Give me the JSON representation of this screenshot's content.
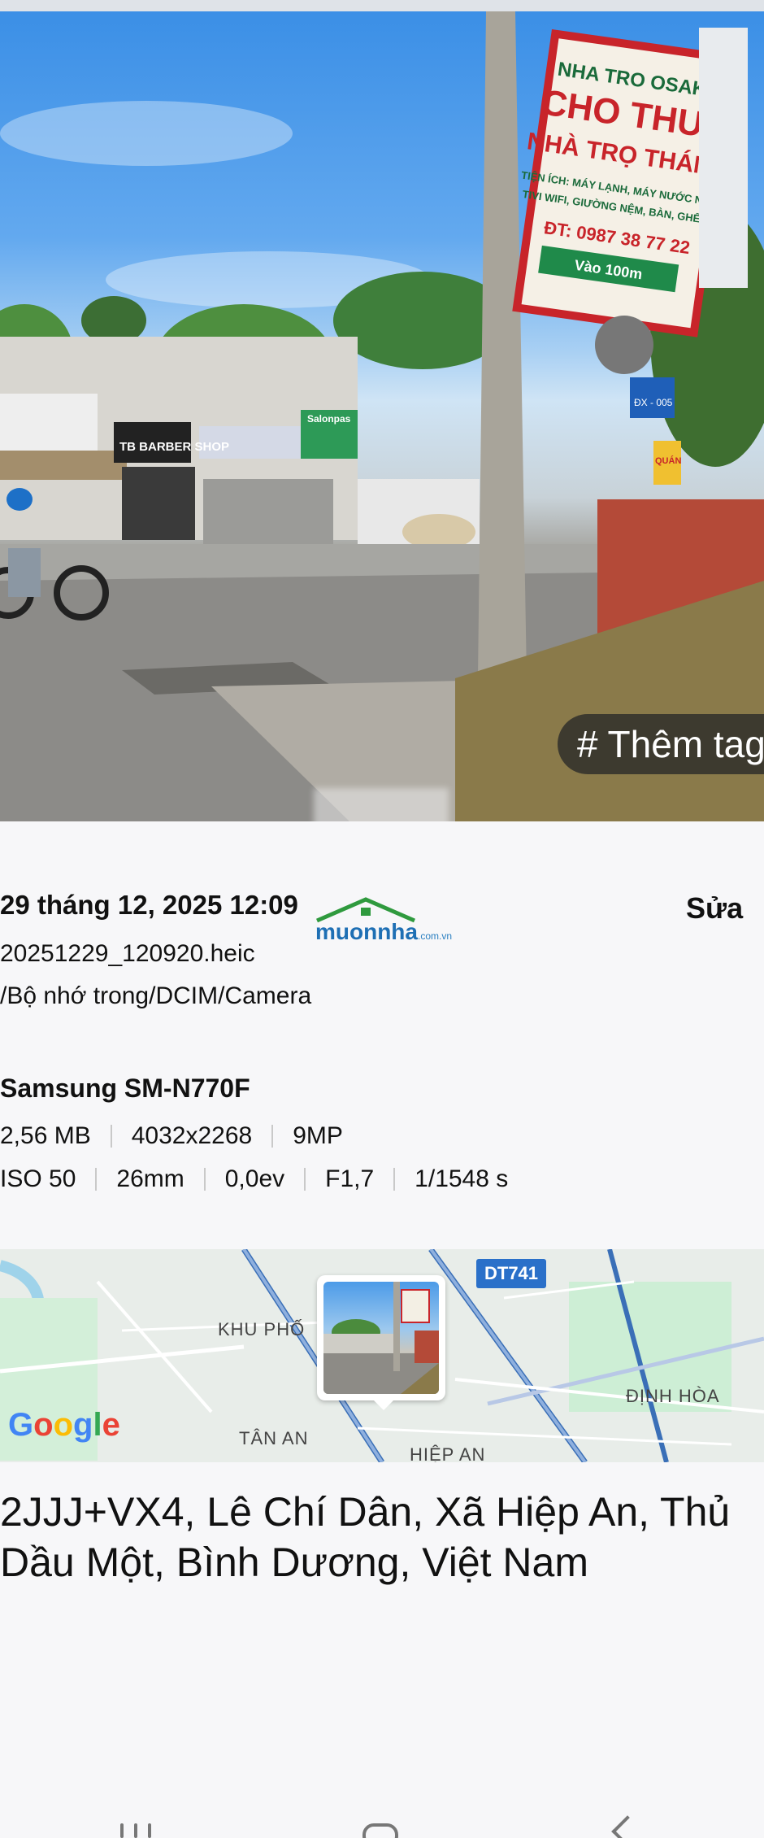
{
  "photo": {
    "tag_chip": "# Thêm tag",
    "signs": {
      "big_sign_lines": [
        "NHA TRO OSAKA",
        "CHO THUÊ",
        "NHÀ TRỌ THÁNG",
        "TIỆN ÍCH: MÁY LẠNH, MÁY NƯỚC NÓNG",
        "TIVI WIFI, GIƯỜNG NỆM, BÀN, GHẾ, TỦ",
        "ĐT: 0987 38 77 22",
        "Vào 100m"
      ],
      "barber": "TB BARBER SHOP",
      "salonpas": "Salonpas",
      "street_sign": "ĐX - 005",
      "quan_sign": "QUÁN"
    }
  },
  "details": {
    "date": "29 tháng 12, 2025 12:09",
    "edit_label": "Sửa",
    "filename": "20251229_120920.heic",
    "path": "/Bộ nhớ trong/DCIM/Camera",
    "device": "Samsung SM-N770F",
    "row1": [
      "2,56 MB",
      "4032x2268",
      "9MP"
    ],
    "row2": [
      "ISO 50",
      "26mm",
      "0,0ev",
      "F1,7",
      "1/1548 s"
    ]
  },
  "watermark": {
    "brand": "muonnha",
    "domain": ".com.vn"
  },
  "map": {
    "labels": {
      "khu_pho": "KHU PHỐ",
      "dinh_hoa": "ĐỊNH HÒA",
      "tan_an": "TÂN AN",
      "hiep_an": "HIỆP AN"
    },
    "road_shield": "DT741",
    "google": [
      "G",
      "o",
      "o",
      "g",
      "l",
      "e"
    ]
  },
  "address": "2JJJ+VX4, Lê Chí Dân, Xã Hiệp An, Thủ Dầu Một, Bình Dương, Việt Nam",
  "colors": {
    "google_blue": "#4285F4",
    "google_red": "#EA4335",
    "google_yellow": "#FBBC05",
    "google_green": "#34A853"
  }
}
